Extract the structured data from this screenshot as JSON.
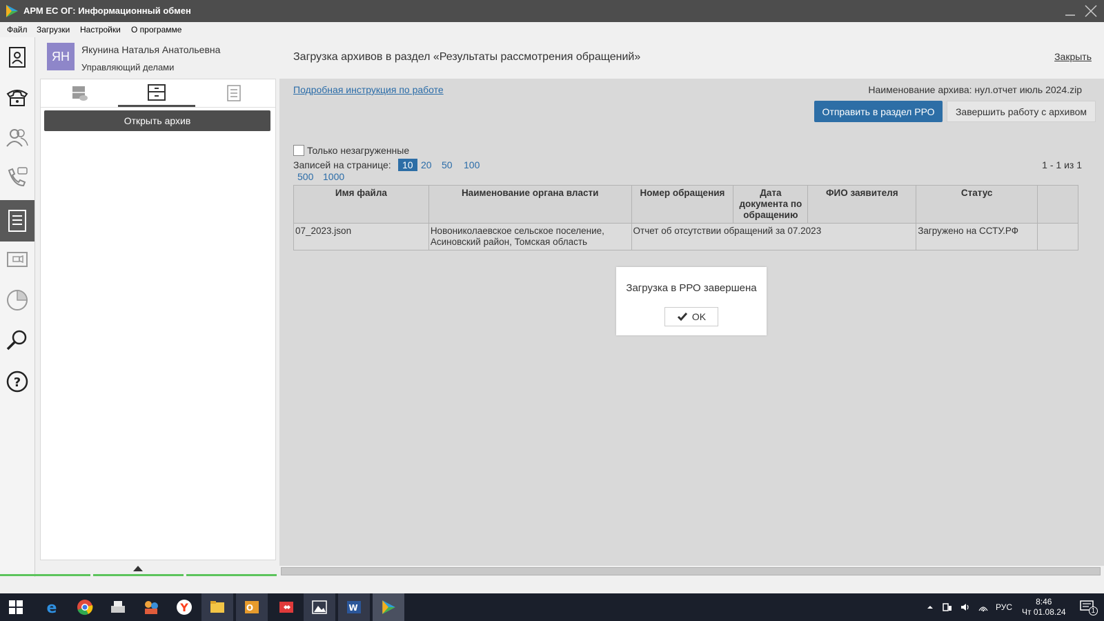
{
  "window": {
    "title": "АРМ ЕС ОГ: Информационный обмен"
  },
  "menu": [
    "Файл",
    "Загрузки",
    "Настройки",
    "О программе"
  ],
  "user": {
    "initials": "ЯН",
    "name": "Якунина Наталья Анатольевна",
    "role": "Управляющий делами"
  },
  "left_panel": {
    "open_archive_label": "Открыть архив"
  },
  "main": {
    "title": "Загрузка архивов в раздел «Результаты рассмотрения обращений»",
    "close_label": "Закрыть",
    "instruction_link": "Подробная инструкция по работе",
    "archive_name": "Наименование архива: нул.отчет июль 2024.zip",
    "send_button": "Отправить в раздел РРО",
    "finish_button": "Завершить работу с архивом",
    "only_unloaded_label": "Только незагруженные",
    "per_page_label": "Записей на странице:",
    "per_page_options": [
      "10",
      "20",
      "50",
      "100",
      "500",
      "1000"
    ],
    "per_page_selected": "10",
    "range_text": "1 - 1 из 1",
    "table": {
      "headers": [
        "Имя файла",
        "Наименование органа власти",
        "Номер обращения",
        "Дата документа по обращению",
        "ФИО заявителя",
        "Статус",
        ""
      ],
      "rows": [
        {
          "file": "07_2023.json",
          "authority": "Новониколаевское сельское поселение, Асиновский район, Томская область",
          "number": "Отчет об отсутствии обращений за 07.2023",
          "status": "Загружено на ССТУ.РФ"
        }
      ]
    }
  },
  "dialog": {
    "message": "Загрузка в РРО завершена",
    "ok_label": "OK"
  },
  "taskbar": {
    "lang": "РУС",
    "time": "8:46",
    "date": "Чт 01.08.24",
    "notifications": "1"
  },
  "colors": {
    "accent": "#2d6ea6",
    "active_dark": "#4d4d4d",
    "avatar": "#8e86c9",
    "progress": "#5cc45c"
  }
}
